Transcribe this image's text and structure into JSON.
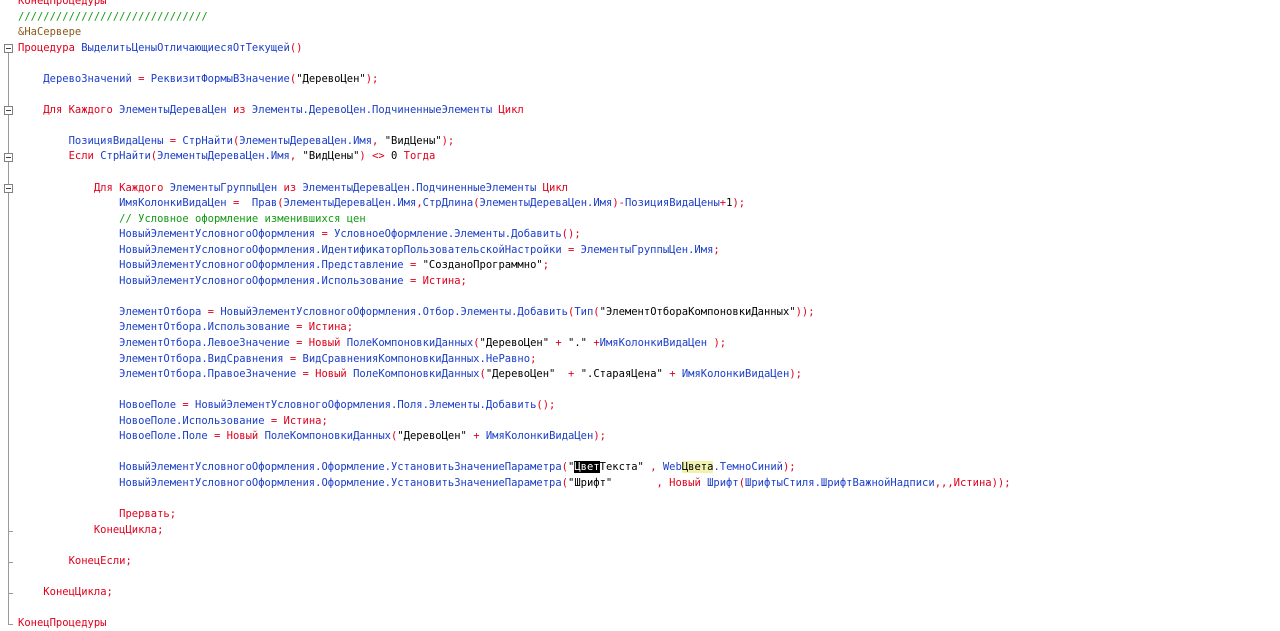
{
  "editor": {
    "lines": [
      {
        "indent": 0,
        "parts": [
          [
            "k",
            "КонецПроцедуры"
          ]
        ]
      },
      {
        "indent": 0,
        "parts": [
          [
            "c",
            "//////////////////////////////"
          ]
        ]
      },
      {
        "indent": 0,
        "parts": [
          [
            "p",
            "&НаСервере"
          ]
        ]
      },
      {
        "indent": 0,
        "parts": [
          [
            "k",
            "Процедура "
          ],
          [
            "i",
            "ВыделитьЦеныОтличающиесяОтТекущей"
          ],
          [
            "k",
            "()"
          ]
        ]
      },
      {
        "indent": 0,
        "parts": []
      },
      {
        "indent": 1,
        "parts": [
          [
            "i",
            "ДеревоЗначений"
          ],
          [
            "k",
            " = "
          ],
          [
            "i",
            "РеквизитФормыВЗначение"
          ],
          [
            "k",
            "("
          ],
          [
            "s",
            "\"ДеревоЦен\""
          ],
          [
            "k",
            ");"
          ]
        ]
      },
      {
        "indent": 0,
        "parts": []
      },
      {
        "indent": 1,
        "parts": [
          [
            "k",
            "Для Каждого "
          ],
          [
            "i",
            "ЭлементыДереваЦен"
          ],
          [
            "k",
            " из "
          ],
          [
            "i",
            "Элементы.ДеревоЦен.ПодчиненныеЭлементы"
          ],
          [
            "k",
            " Цикл"
          ]
        ]
      },
      {
        "indent": 0,
        "parts": []
      },
      {
        "indent": 2,
        "parts": [
          [
            "i",
            "ПозицияВидаЦены"
          ],
          [
            "k",
            " = "
          ],
          [
            "i",
            "СтрНайти"
          ],
          [
            "k",
            "("
          ],
          [
            "i",
            "ЭлементыДереваЦен.Имя"
          ],
          [
            "k",
            ", "
          ],
          [
            "s",
            "\"ВидЦены\""
          ],
          [
            "k",
            ");"
          ]
        ]
      },
      {
        "indent": 2,
        "parts": [
          [
            "k",
            "Если "
          ],
          [
            "i",
            "СтрНайти"
          ],
          [
            "k",
            "("
          ],
          [
            "i",
            "ЭлементыДереваЦен.Имя"
          ],
          [
            "k",
            ", "
          ],
          [
            "s",
            "\"ВидЦены\""
          ],
          [
            "k",
            ") <> "
          ],
          [
            "s",
            "0"
          ],
          [
            "k",
            " Тогда"
          ]
        ]
      },
      {
        "indent": 0,
        "parts": []
      },
      {
        "indent": 3,
        "parts": [
          [
            "k",
            "Для Каждого "
          ],
          [
            "i",
            "ЭлементыГруппыЦен"
          ],
          [
            "k",
            " из "
          ],
          [
            "i",
            "ЭлементыДереваЦен.ПодчиненныеЭлементы"
          ],
          [
            "k",
            " Цикл"
          ]
        ]
      },
      {
        "indent": 4,
        "parts": [
          [
            "i",
            "ИмяКолонкиВидаЦен"
          ],
          [
            "k",
            " =  "
          ],
          [
            "i",
            "Прав"
          ],
          [
            "k",
            "("
          ],
          [
            "i",
            "ЭлементыДереваЦен.Имя"
          ],
          [
            "k",
            ","
          ],
          [
            "i",
            "СтрДлина"
          ],
          [
            "k",
            "("
          ],
          [
            "i",
            "ЭлементыДереваЦен.Имя"
          ],
          [
            "k",
            ")-"
          ],
          [
            "i",
            "ПозицияВидаЦены"
          ],
          [
            "k",
            "+"
          ],
          [
            "s",
            "1"
          ],
          [
            "k",
            ");"
          ]
        ]
      },
      {
        "indent": 4,
        "parts": [
          [
            "c",
            "// Условное оформление изменившихся цен"
          ]
        ]
      },
      {
        "indent": 4,
        "parts": [
          [
            "i",
            "НовыйЭлементУсловногоОформления"
          ],
          [
            "k",
            " = "
          ],
          [
            "i",
            "УсловноеОформление.Элементы.Добавить"
          ],
          [
            "k",
            "();"
          ]
        ]
      },
      {
        "indent": 4,
        "parts": [
          [
            "i",
            "НовыйЭлементУсловногоОформления.ИдентификаторПользовательскойНастройки"
          ],
          [
            "k",
            " = "
          ],
          [
            "i",
            "ЭлементыГруппыЦен.Имя"
          ],
          [
            "k",
            ";"
          ]
        ]
      },
      {
        "indent": 4,
        "parts": [
          [
            "i",
            "НовыйЭлементУсловногоОформления.Представление"
          ],
          [
            "k",
            " = "
          ],
          [
            "s",
            "\"СозданоПрограммно\""
          ],
          [
            "k",
            ";"
          ]
        ]
      },
      {
        "indent": 4,
        "parts": [
          [
            "i",
            "НовыйЭлементУсловногоОформления.Использование"
          ],
          [
            "k",
            " = Истина;"
          ]
        ]
      },
      {
        "indent": 0,
        "parts": []
      },
      {
        "indent": 4,
        "parts": [
          [
            "i",
            "ЭлементОтбора"
          ],
          [
            "k",
            " = "
          ],
          [
            "i",
            "НовыйЭлементУсловногоОформления.Отбор.Элементы.Добавить"
          ],
          [
            "k",
            "("
          ],
          [
            "i",
            "Тип"
          ],
          [
            "k",
            "("
          ],
          [
            "s",
            "\"ЭлементОтбораКомпоновкиДанных\""
          ],
          [
            "k",
            "));"
          ]
        ]
      },
      {
        "indent": 4,
        "parts": [
          [
            "i",
            "ЭлементОтбора.Использование"
          ],
          [
            "k",
            " = Истина;"
          ]
        ]
      },
      {
        "indent": 4,
        "parts": [
          [
            "i",
            "ЭлементОтбора.ЛевоеЗначение"
          ],
          [
            "k",
            " = Новый "
          ],
          [
            "i",
            "ПолеКомпоновкиДанных"
          ],
          [
            "k",
            "("
          ],
          [
            "s",
            "\"ДеревоЦен\""
          ],
          [
            "k",
            " + "
          ],
          [
            "s",
            "\".\""
          ],
          [
            "k",
            " +"
          ],
          [
            "i",
            "ИмяКолонкиВидаЦен"
          ],
          [
            "k",
            " );"
          ]
        ]
      },
      {
        "indent": 4,
        "parts": [
          [
            "i",
            "ЭлементОтбора.ВидСравнения"
          ],
          [
            "k",
            " = "
          ],
          [
            "i",
            "ВидСравненияКомпоновкиДанных.НеРавно"
          ],
          [
            "k",
            ";"
          ]
        ]
      },
      {
        "indent": 4,
        "parts": [
          [
            "i",
            "ЭлементОтбора.ПравоеЗначение"
          ],
          [
            "k",
            " = Новый "
          ],
          [
            "i",
            "ПолеКомпоновкиДанных"
          ],
          [
            "k",
            "("
          ],
          [
            "s",
            "\"ДеревоЦен\""
          ],
          [
            "k",
            "  + "
          ],
          [
            "s",
            "\".СтараяЦена\""
          ],
          [
            "k",
            " + "
          ],
          [
            "i",
            "ИмяКолонкиВидаЦен"
          ],
          [
            "k",
            ");"
          ]
        ]
      },
      {
        "indent": 0,
        "parts": []
      },
      {
        "indent": 4,
        "parts": [
          [
            "i",
            "НовоеПоле"
          ],
          [
            "k",
            " = "
          ],
          [
            "i",
            "НовыйЭлементУсловногоОформления.Поля.Элементы.Добавить"
          ],
          [
            "k",
            "();"
          ]
        ]
      },
      {
        "indent": 4,
        "parts": [
          [
            "i",
            "НовоеПоле.Использование"
          ],
          [
            "k",
            " = Истина;"
          ]
        ]
      },
      {
        "indent": 4,
        "parts": [
          [
            "i",
            "НовоеПоле.Поле"
          ],
          [
            "k",
            " = Новый "
          ],
          [
            "i",
            "ПолеКомпоновкиДанных"
          ],
          [
            "k",
            "("
          ],
          [
            "s",
            "\"ДеревоЦен\""
          ],
          [
            "k",
            " + "
          ],
          [
            "i",
            "ИмяКолонкиВидаЦен"
          ],
          [
            "k",
            ");"
          ]
        ]
      },
      {
        "indent": 0,
        "parts": []
      },
      {
        "indent": 4,
        "parts": [
          [
            "i",
            "НовыйЭлементУсловногоОформления.Оформление.УстановитьЗначениеПараметра"
          ],
          [
            "k",
            "("
          ],
          [
            "s",
            "\""
          ],
          [
            "sel",
            "Цвет"
          ],
          [
            "s",
            "Текста\""
          ],
          [
            "k",
            " , "
          ],
          [
            "i",
            "Web"
          ],
          [
            "hl",
            "Цвета"
          ],
          [
            "i",
            ".ТемноСиний"
          ],
          [
            "k",
            ");"
          ]
        ]
      },
      {
        "indent": 4,
        "parts": [
          [
            "i",
            "НовыйЭлементУсловногоОформления.Оформление.УстановитьЗначениеПараметра"
          ],
          [
            "k",
            "("
          ],
          [
            "s",
            "\"Шрифт\"      "
          ],
          [
            "k",
            " , Новый "
          ],
          [
            "i",
            "Шрифт"
          ],
          [
            "k",
            "("
          ],
          [
            "i",
            "ШрифтыСтиля.ШрифтВажнойНадписи"
          ],
          [
            "k",
            ",,,Истина));"
          ]
        ]
      },
      {
        "indent": 0,
        "parts": []
      },
      {
        "indent": 4,
        "parts": [
          [
            "k",
            "Прервать;"
          ]
        ]
      },
      {
        "indent": 3,
        "parts": [
          [
            "k",
            "КонецЦикла;"
          ]
        ]
      },
      {
        "indent": 0,
        "parts": []
      },
      {
        "indent": 2,
        "parts": [
          [
            "k",
            "КонецЕсли;"
          ]
        ]
      },
      {
        "indent": 0,
        "parts": []
      },
      {
        "indent": 1,
        "parts": [
          [
            "k",
            "КонецЦикла;"
          ]
        ]
      },
      {
        "indent": 0,
        "parts": []
      },
      {
        "indent": 0,
        "parts": [
          [
            "k",
            "КонецПроцедуры"
          ]
        ]
      }
    ],
    "fold_markers": [
      3,
      7,
      10,
      12
    ],
    "fold_ends": [
      34,
      36,
      38,
      40
    ],
    "colors": {
      "keyword": "#e0001c",
      "identifier": "#1b3ec8",
      "string": "#000000",
      "comment": "#119a11",
      "preprocessor": "#8a5a1a",
      "selection_bg": "#000000",
      "word_highlight_bg": "#f2f2b0"
    }
  }
}
